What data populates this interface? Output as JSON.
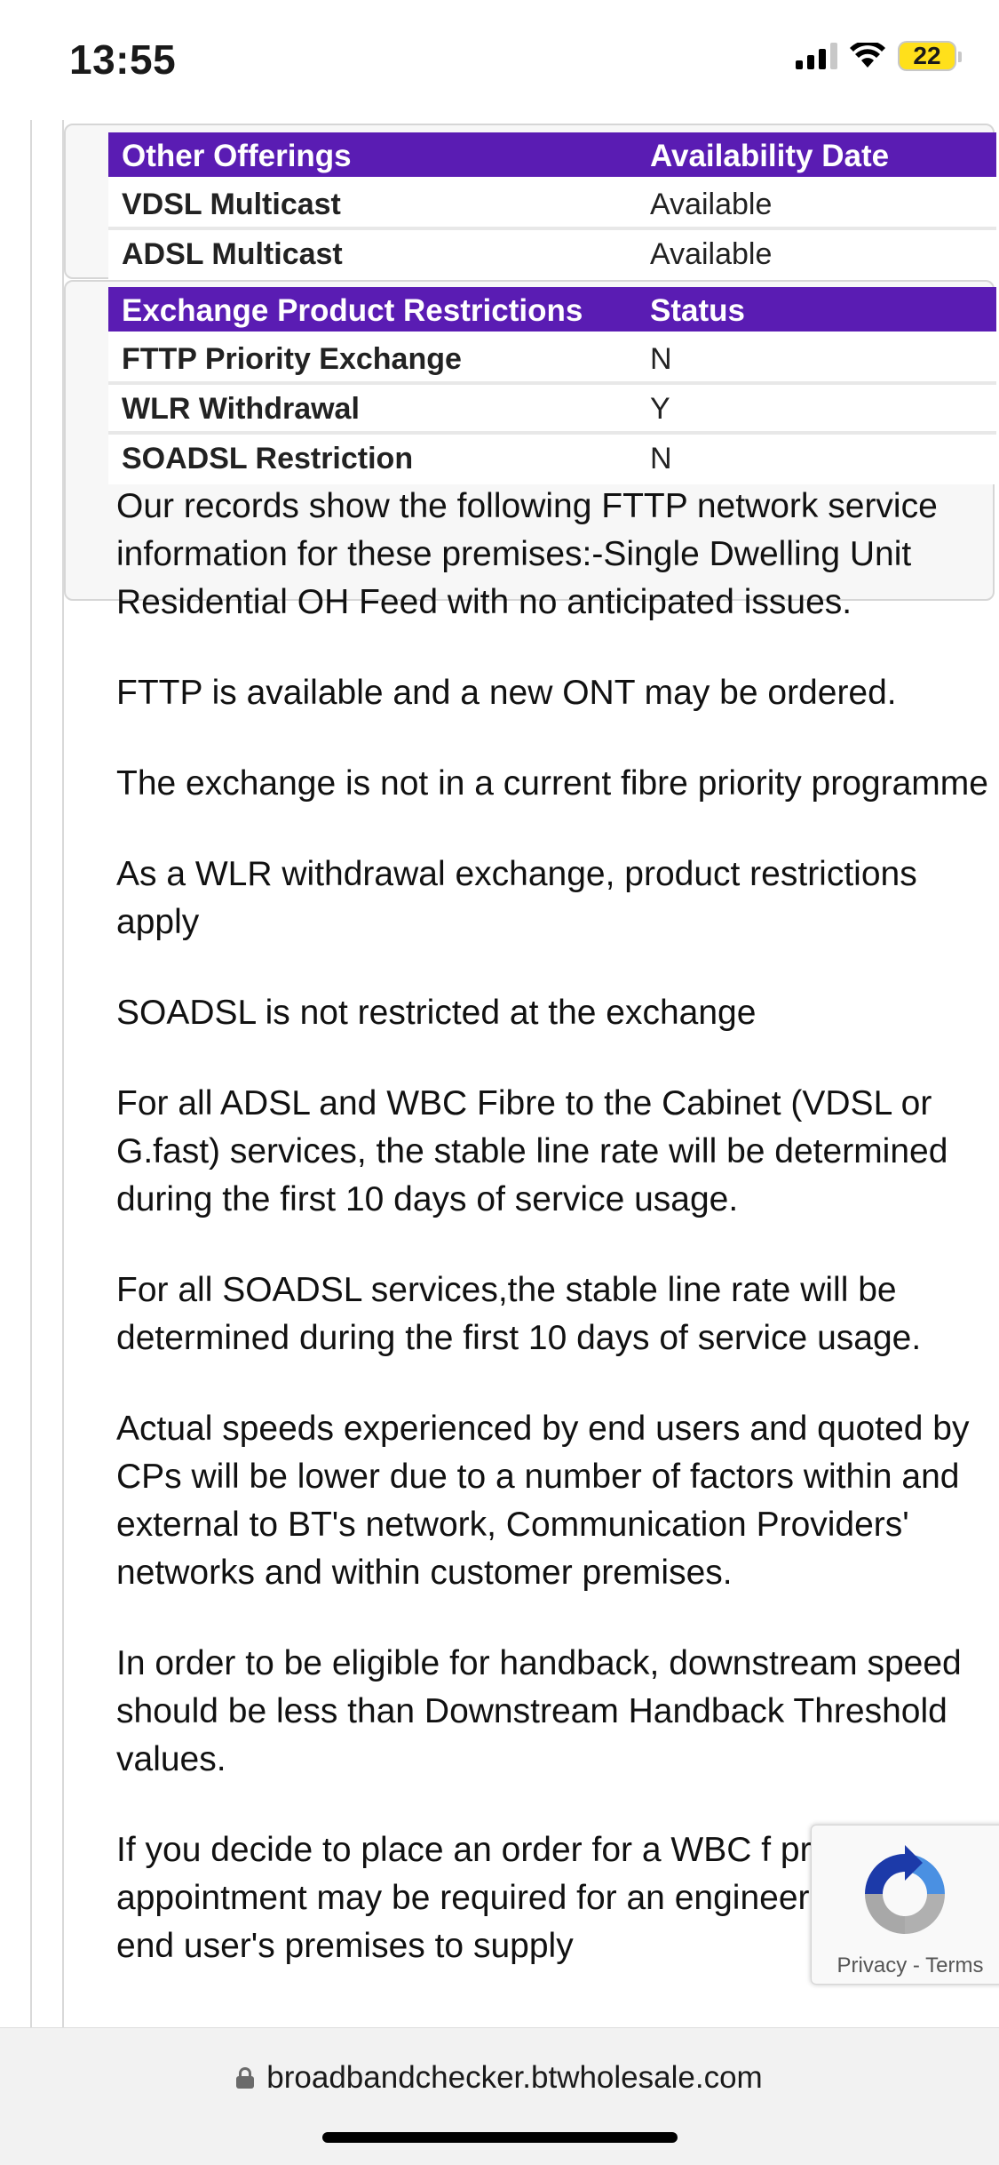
{
  "status_bar": {
    "time": "13:55",
    "battery": "22"
  },
  "table_other_offerings": {
    "headers": [
      "Other Offerings",
      "Availability Date"
    ],
    "rows": [
      [
        "VDSL Multicast",
        "Available"
      ],
      [
        "ADSL Multicast",
        "Available"
      ]
    ]
  },
  "table_exchange_restrictions": {
    "headers": [
      "Exchange Product Restrictions",
      "Status"
    ],
    "rows": [
      [
        "FTTP Priority Exchange",
        "N"
      ],
      [
        "WLR Withdrawal",
        "Y"
      ],
      [
        "SOADSL Restriction",
        "N"
      ]
    ]
  },
  "paragraphs": [
    "Our records show the following FTTP network service information for these premises:-Single Dwelling Unit Residential OH Feed with no anticipated issues.",
    "FTTP is available and a new ONT may be ordered.",
    "The exchange is not in a current fibre priority programme",
    "As a WLR withdrawal exchange, product restrictions apply",
    "SOADSL is not restricted at the exchange",
    "For all ADSL and WBC Fibre to the Cabinet (VDSL or G.fast) services, the stable line rate will be determined during the first 10 days of service usage.",
    "For all SOADSL services,the stable line rate will be determined during the first 10 days of service usage.",
    "Actual speeds experienced by end users and quoted by CPs will be lower due to a number of factors within and external to BT's network, Communication Providers' networks and within customer premises.",
    "In order to be eligible for handback, downstream speed should be less than Downstream Handback Threshold values.",
    "If you decide to place an order for a WBC f product, an appointment may be required for an engineer to visit the end user's premises to supply"
  ],
  "recaptcha": {
    "links": "Privacy - Terms"
  },
  "browser": {
    "url": "broadbandchecker.btwholesale.com"
  },
  "colors": {
    "table_header": "#5a1cb3",
    "battery": "#ffe01b"
  }
}
